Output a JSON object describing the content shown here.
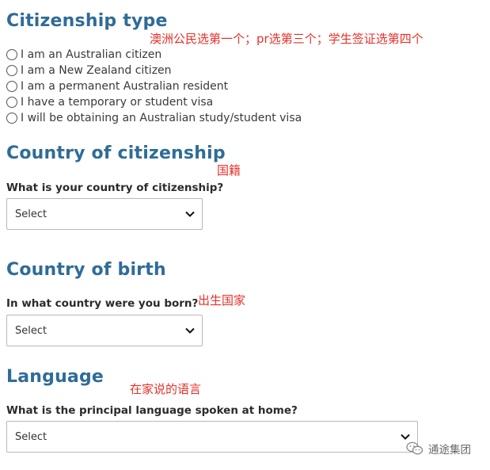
{
  "citizenship_type": {
    "heading": "Citizenship type",
    "note": "澳洲公民选第一个；pr选第三个；学生签证选第四个",
    "options": [
      "I am an Australian citizen",
      "I am a New Zealand citizen",
      "I am a permanent Australian resident",
      "I have a temporary or student visa",
      "I will be obtaining an Australian study/student visa"
    ]
  },
  "country_of_citizenship": {
    "heading": "Country of citizenship",
    "note": "国籍",
    "question": "What is your country of citizenship?",
    "select_value": "Select"
  },
  "country_of_birth": {
    "heading": "Country of birth",
    "note": "出生国家",
    "question": "In what country were you born?",
    "select_value": "Select"
  },
  "language": {
    "heading": "Language",
    "note": "在家说的语言",
    "question": "What is the principal language spoken at home?",
    "select_value": "Select"
  },
  "watermark": {
    "text": "通途集团",
    "icon": "wechat-icon"
  }
}
